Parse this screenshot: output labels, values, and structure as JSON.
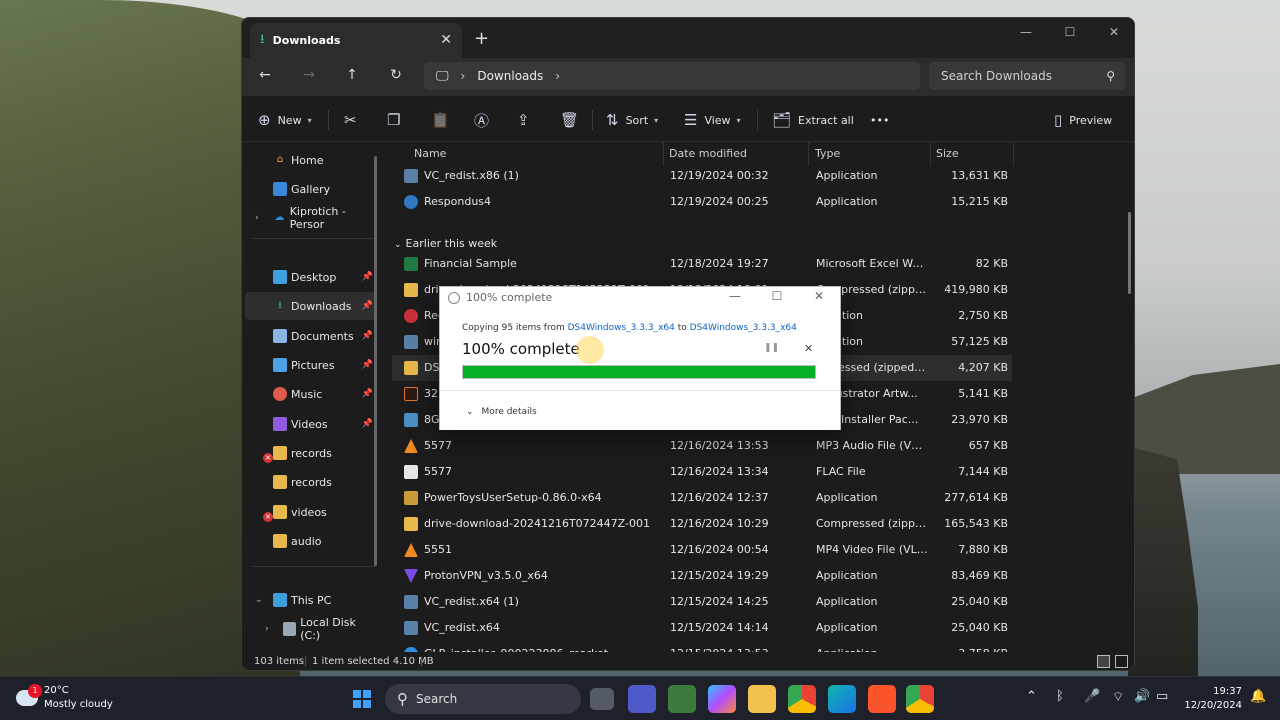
{
  "explorer": {
    "tab_title": "Downloads",
    "new_tab": "+",
    "address": {
      "location": "Downloads"
    },
    "search_placeholder": "Search Downloads",
    "toolbar": {
      "new": "New",
      "sort": "Sort",
      "view": "View",
      "extract_all": "Extract all",
      "more": "•••",
      "preview": "Preview"
    },
    "sidebar": {
      "items": [
        {
          "label": "Home",
          "icon": "home-icon"
        },
        {
          "label": "Gallery",
          "icon": "gallery-icon"
        },
        {
          "label": "Kiprotich - Persor",
          "icon": "onedrive-icon"
        },
        {
          "label": "Desktop",
          "icon": "desktop-icon"
        },
        {
          "label": "Downloads",
          "icon": "download-icon"
        },
        {
          "label": "Documents",
          "icon": "documents-icon"
        },
        {
          "label": "Pictures",
          "icon": "pictures-icon"
        },
        {
          "label": "Music",
          "icon": "music-icon"
        },
        {
          "label": "Videos",
          "icon": "videos-icon"
        },
        {
          "label": "records",
          "icon": "folder-icon"
        },
        {
          "label": "records",
          "icon": "folder-icon"
        },
        {
          "label": "videos",
          "icon": "folder-icon"
        },
        {
          "label": "audio",
          "icon": "folder-icon"
        },
        {
          "label": "This PC",
          "icon": "pc-icon"
        },
        {
          "label": "Local Disk (C:)",
          "icon": "disk-icon"
        }
      ]
    },
    "columns": {
      "name": "Name",
      "date": "Date modified",
      "type": "Type",
      "size": "Size"
    },
    "group_label": "Earlier this week",
    "files": [
      {
        "name": "VC_redist.x86 (1)",
        "date": "12/19/2024 00:32",
        "type": "Application",
        "size": "13,631 KB"
      },
      {
        "name": "Respondus4",
        "date": "12/19/2024 00:25",
        "type": "Application",
        "size": "15,215 KB"
      },
      {
        "name": "Financial Sample",
        "date": "12/18/2024 19:27",
        "type": "Microsoft Excel Works...",
        "size": "82 KB"
      },
      {
        "name": "drive-download-20241218T145239Z-001",
        "date": "12/18/2024 18:01",
        "type": "Compressed (zipped) ...",
        "size": "419,980 KB"
      },
      {
        "name": "Rec",
        "date": "",
        "type": "plication",
        "size": "2,750 KB"
      },
      {
        "name": "win",
        "date": "",
        "type": "plication",
        "size": "57,125 KB"
      },
      {
        "name": "DS4",
        "date": "",
        "type": "mpressed (zipped) ...",
        "size": "4,207 KB"
      },
      {
        "name": "327",
        "date": "",
        "type": "e Illustrator Artw...",
        "size": "5,141 KB"
      },
      {
        "name": "8Ga",
        "date": "",
        "type": "ows Installer Pac...",
        "size": "23,970 KB"
      },
      {
        "name": "5577",
        "date": "12/16/2024 13:53",
        "type": "MP3 Audio File (VLC)",
        "size": "657 KB"
      },
      {
        "name": "5577",
        "date": "12/16/2024 13:34",
        "type": "FLAC File",
        "size": "7,144 KB"
      },
      {
        "name": "PowerToysUserSetup-0.86.0-x64",
        "date": "12/16/2024 12:37",
        "type": "Application",
        "size": "277,614 KB"
      },
      {
        "name": "drive-download-20241216T072447Z-001",
        "date": "12/16/2024 10:29",
        "type": "Compressed (zipped) ...",
        "size": "165,543 KB"
      },
      {
        "name": "5551",
        "date": "12/16/2024 00:54",
        "type": "MP4 Video File (VLC)",
        "size": "7,880 KB"
      },
      {
        "name": "ProtonVPN_v3.5.0_x64",
        "date": "12/15/2024 19:29",
        "type": "Application",
        "size": "83,469 KB"
      },
      {
        "name": "VC_redist.x64 (1)",
        "date": "12/15/2024 14:25",
        "type": "Application",
        "size": "25,040 KB"
      },
      {
        "name": "VC_redist.x64",
        "date": "12/15/2024 14:14",
        "type": "Application",
        "size": "25,040 KB"
      },
      {
        "name": "GLP_installer_900223086_market",
        "date": "12/15/2024 13:53",
        "type": "Application",
        "size": "3,758 KB"
      }
    ],
    "status": {
      "count": "103 items",
      "selected": "1 item selected  4.10 MB"
    }
  },
  "copy_dialog": {
    "title": "100% complete",
    "copy_prefix": "Copying 95 items from",
    "source": "DS4Windows_3.3.3_x64",
    "to": "to",
    "destination": "DS4Windows_3.3.3_x64",
    "progress_text": "100% complete",
    "progress_percent": 100,
    "progress_color": "#06b025",
    "more_details": "More details"
  },
  "taskbar": {
    "weather_temp": "20°C",
    "weather_desc": "Mostly cloudy",
    "weather_badge": "1",
    "search_label": "Search",
    "time": "19:37",
    "date": "12/20/2024"
  }
}
